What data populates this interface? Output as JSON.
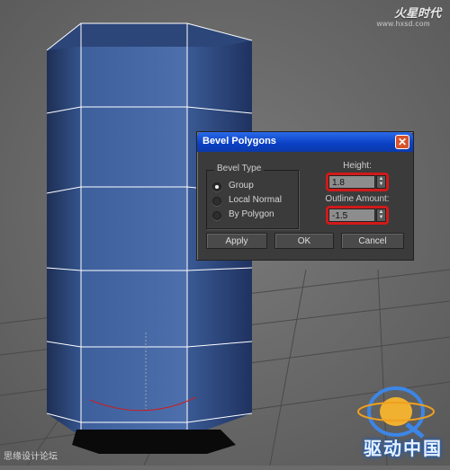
{
  "watermark_top": "火星时代",
  "watermark_url": "www.hxsd.com",
  "watermark_bottom_left": "思缘设计论坛",
  "logo_text": "驱动中国",
  "dialog": {
    "title": "Bevel Polygons",
    "close_glyph": "✕",
    "bevel_type": {
      "legend": "Bevel Type",
      "options": [
        {
          "label": "Group",
          "selected": true
        },
        {
          "label": "Local Normal",
          "selected": false
        },
        {
          "label": "By Polygon",
          "selected": false
        }
      ]
    },
    "height": {
      "label": "Height:",
      "value": "1.8"
    },
    "outline_amount": {
      "label": "Outline Amount:",
      "value": "-1.5"
    },
    "buttons": {
      "apply": "Apply",
      "ok": "OK",
      "cancel": "Cancel"
    }
  },
  "colors": {
    "object_blue": "#3d5f9c",
    "highlight_red": "#d11a1a",
    "titlebar_blue": "#0a3fc4",
    "dialog_bg": "#3b3b3b",
    "viewport_bg": "#6b6b6b"
  },
  "icons": {
    "close": "close-icon",
    "spinner": "spinner-arrows-icon",
    "radio": "radio-button-icon"
  }
}
